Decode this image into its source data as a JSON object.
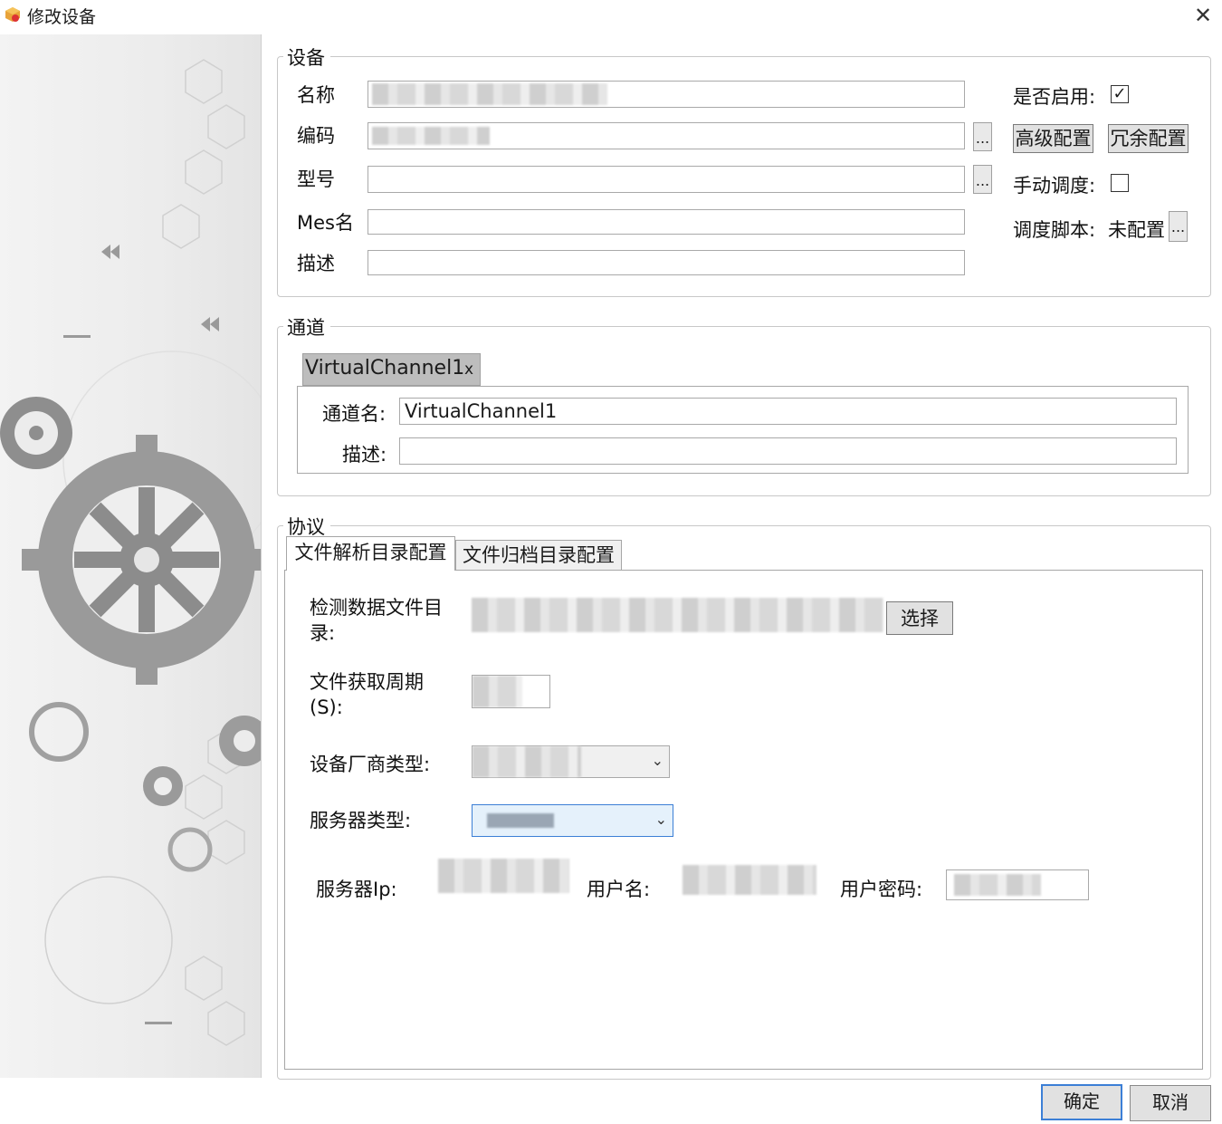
{
  "window": {
    "title": "修改设备",
    "close_label": "✕"
  },
  "device": {
    "group_label": "设备",
    "name_label": "名称",
    "code_label": "编码",
    "model_label": "型号",
    "mes_label": "Mes名",
    "desc_label": "描述",
    "enabled_label": "是否启用:",
    "enabled": true,
    "advanced_button": "高级配置",
    "redundant_button": "冗余配置",
    "manual_label": "手动调度:",
    "manual": false,
    "script_label": "调度脚本:",
    "script_value": "未配置",
    "dots_label": "..."
  },
  "channel": {
    "group_label": "通道",
    "tab_label": "VirtualChannel1",
    "tab_close": "x",
    "name_label": "通道名:",
    "name_value": "VirtualChannel1",
    "desc_label": "描述:"
  },
  "protocol": {
    "group_label": "协议",
    "tabs": [
      "文件解析目录配置",
      "文件归档目录配置"
    ],
    "dir_label_1": "检测数据文件目",
    "dir_label_2": "录:",
    "select_button": "选择",
    "period_label_1": "文件获取周期",
    "period_label_2": "(S):",
    "vendor_label": "设备厂商类型:",
    "server_type_label": "服务器类型:",
    "server_ip_label": "服务器Ip:",
    "username_label": "用户名:",
    "password_label": "用户密码:"
  },
  "footer": {
    "ok_label": "确定",
    "cancel_label": "取消"
  },
  "icons": {
    "app": "app-logo-icon",
    "close": "close-icon",
    "check": "checkmark-icon",
    "dropdown": "chevron-down-icon"
  },
  "colors": {
    "accent_border": "#3c7fd6",
    "group_border": "#c8c8c8",
    "button_bg": "#e1e1e1"
  }
}
